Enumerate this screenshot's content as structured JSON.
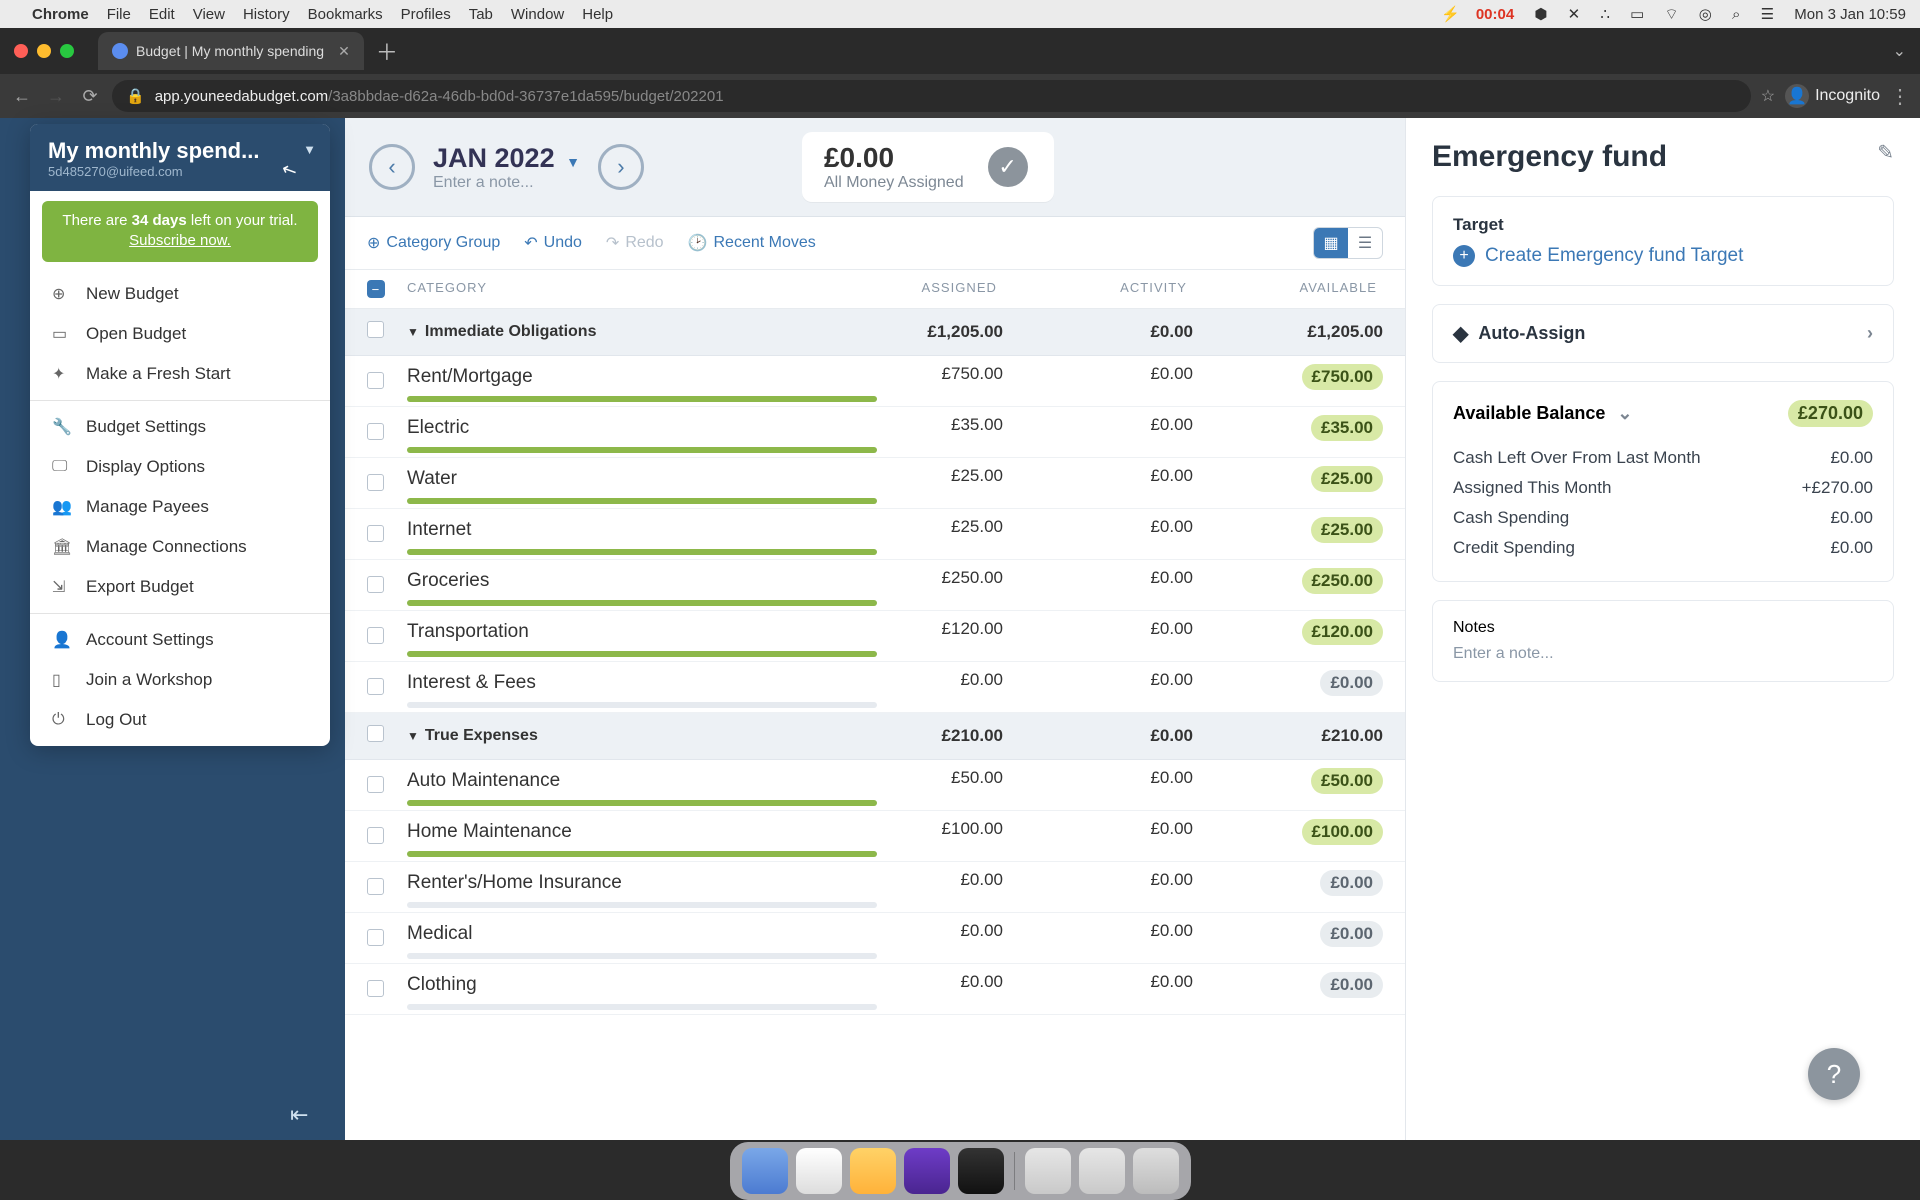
{
  "menubar": {
    "app": "Chrome",
    "items": [
      "File",
      "Edit",
      "View",
      "History",
      "Bookmarks",
      "Profiles",
      "Tab",
      "Window",
      "Help"
    ],
    "battery": "00:04",
    "datetime": "Mon 3 Jan  10:59"
  },
  "browser": {
    "tab_title": "Budget | My monthly spending",
    "url_domain": "app.youneedabudget.com",
    "url_path": "/3a8bbdae-d62a-46db-bd0d-36737e1da595/budget/202201",
    "incognito_label": "Incognito"
  },
  "budget_menu": {
    "name": "My monthly spend...",
    "email": "5d485270@uifeed.com",
    "trial_prefix": "There are ",
    "trial_days": "34 days",
    "trial_suffix": " left on your trial. ",
    "subscribe": "Subscribe now.",
    "items_a": [
      "New Budget",
      "Open Budget",
      "Make a Fresh Start"
    ],
    "items_b": [
      "Budget Settings",
      "Display Options",
      "Manage Payees",
      "Manage Connections",
      "Export Budget"
    ],
    "items_c": [
      "Account Settings",
      "Join a Workshop",
      "Log Out"
    ]
  },
  "header": {
    "month": "JAN 2022",
    "note_placeholder": "Enter a note...",
    "assigned_amount": "£0.00",
    "assigned_label": "All Money Assigned"
  },
  "toolbar": {
    "category_group": "Category Group",
    "undo": "Undo",
    "redo": "Redo",
    "recent_moves": "Recent Moves"
  },
  "columns": {
    "category": "CATEGORY",
    "assigned": "ASSIGNED",
    "activity": "ACTIVITY",
    "available": "AVAILABLE"
  },
  "groups": [
    {
      "name": "Immediate Obligations",
      "assigned": "£1,205.00",
      "activity": "£0.00",
      "available": "£1,205.00",
      "cats": [
        {
          "name": "Rent/Mortgage",
          "assigned": "£750.00",
          "activity": "£0.00",
          "available": "£750.00",
          "full": true
        },
        {
          "name": "Electric",
          "assigned": "£35.00",
          "activity": "£0.00",
          "available": "£35.00",
          "full": true
        },
        {
          "name": "Water",
          "assigned": "£25.00",
          "activity": "£0.00",
          "available": "£25.00",
          "full": true
        },
        {
          "name": "Internet",
          "assigned": "£25.00",
          "activity": "£0.00",
          "available": "£25.00",
          "full": true
        },
        {
          "name": "Groceries",
          "assigned": "£250.00",
          "activity": "£0.00",
          "available": "£250.00",
          "full": true
        },
        {
          "name": "Transportation",
          "assigned": "£120.00",
          "activity": "£0.00",
          "available": "£120.00",
          "full": true
        },
        {
          "name": "Interest & Fees",
          "assigned": "£0.00",
          "activity": "£0.00",
          "available": "£0.00",
          "full": false
        }
      ]
    },
    {
      "name": "True Expenses",
      "assigned": "£210.00",
      "activity": "£0.00",
      "available": "£210.00",
      "cats": [
        {
          "name": "Auto Maintenance",
          "assigned": "£50.00",
          "activity": "£0.00",
          "available": "£50.00",
          "full": true
        },
        {
          "name": "Home Maintenance",
          "assigned": "£100.00",
          "activity": "£0.00",
          "available": "£100.00",
          "full": true
        },
        {
          "name": "Renter's/Home Insurance",
          "assigned": "£0.00",
          "activity": "£0.00",
          "available": "£0.00",
          "full": false
        },
        {
          "name": "Medical",
          "assigned": "£0.00",
          "activity": "£0.00",
          "available": "£0.00",
          "full": false
        },
        {
          "name": "Clothing",
          "assigned": "£0.00",
          "activity": "£0.00",
          "available": "£0.00",
          "full": false
        }
      ]
    }
  ],
  "right_panel": {
    "title": "Emergency fund",
    "target_label": "Target",
    "create_target": "Create Emergency fund Target",
    "auto_assign": "Auto-Assign",
    "available_balance_label": "Available Balance",
    "available_balance_amount": "£270.00",
    "rows": [
      {
        "label": "Cash Left Over From Last Month",
        "value": "£0.00"
      },
      {
        "label": "Assigned This Month",
        "value": "+£270.00"
      },
      {
        "label": "Cash Spending",
        "value": "£0.00"
      },
      {
        "label": "Credit Spending",
        "value": "£0.00"
      }
    ],
    "notes_label": "Notes",
    "notes_placeholder": "Enter a note..."
  }
}
